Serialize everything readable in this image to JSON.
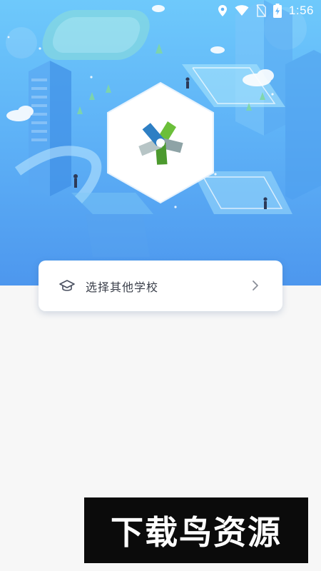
{
  "status_bar": {
    "time": "1:56",
    "icons": [
      "location-pin-icon",
      "wifi-icon",
      "no-sim-icon",
      "battery-charging-icon"
    ]
  },
  "hero": {
    "illustration": "isometric-campus-illustration",
    "logo": "school-app-logo"
  },
  "school_selector": {
    "icon": "graduation-cap-icon",
    "label": "选择其他学校",
    "chevron": "chevron-right-icon"
  },
  "watermark": {
    "text": "下载鸟资源"
  },
  "colors": {
    "hero_top": "#6ec9fb",
    "hero_bottom": "#4d97ee",
    "page_background": "#f7f7f7",
    "card_background": "#ffffff",
    "label_text": "#3a3f4a",
    "watermark_background": "#0b0b0b"
  }
}
